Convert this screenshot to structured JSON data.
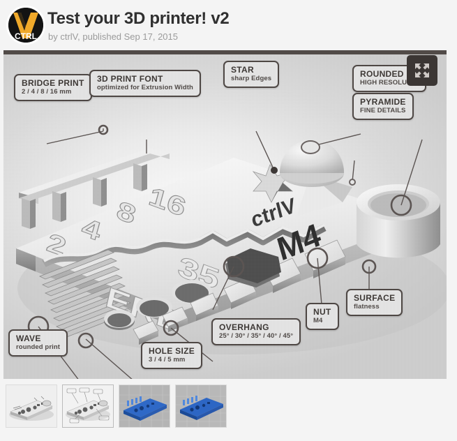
{
  "header": {
    "logo_icon": "ctrlv-logo-icon",
    "logo_text": "CTRL",
    "title": "Test your 3D printer! v2",
    "byline": "by ctrlV, published Sep 17, 2015"
  },
  "viewer": {
    "expand_icon": "expand-arrows-icon",
    "model_text": {
      "brand": "ctrlV",
      "thread": "M4",
      "bridge_numbers": [
        "2",
        "4",
        "8",
        "16"
      ],
      "hole_numbers": [
        "3",
        "4",
        "5"
      ]
    },
    "callouts": [
      {
        "id": "bridge-print",
        "title": "BRIDGE PRINT",
        "sub": "2 / 4 / 8 / 16 mm"
      },
      {
        "id": "3d-print-font",
        "title": "3D PRINT FONT",
        "sub": "optimized for Extrusion Width"
      },
      {
        "id": "star",
        "title": "STAR",
        "sub": "sharp Edges"
      },
      {
        "id": "rounded-print",
        "title": "ROUNDED P",
        "sub": "HIGH RESOLUTIO"
      },
      {
        "id": "pyramide",
        "title": "PYRAMIDE",
        "sub": "FINE DETAILS"
      },
      {
        "id": "wave",
        "title": "WAVE",
        "sub": "rounded print"
      },
      {
        "id": "hole-size",
        "title": "HOLE SIZE",
        "sub": "3 / 4 / 5 mm"
      },
      {
        "id": "overhang",
        "title": "OVERHANG",
        "sub": "25° / 30° / 35° / 40° / 45°"
      },
      {
        "id": "nut",
        "title": "NUT",
        "sub": "M4"
      },
      {
        "id": "surface",
        "title": "SURFACE",
        "sub": "flatness"
      }
    ]
  },
  "thumbnails": [
    {
      "id": "thumb-render-gray",
      "label": "grayscale render"
    },
    {
      "id": "thumb-render-labeled",
      "label": "labeled render",
      "selected": true
    },
    {
      "id": "thumb-print-blue-1",
      "label": "blue print photo 1"
    },
    {
      "id": "thumb-print-blue-2",
      "label": "blue print photo 2"
    }
  ],
  "colors": {
    "page_bg": "#f4f4f4",
    "logo_yellow": "#f0a92a",
    "logo_black": "#131313",
    "topbar": "#514b48",
    "callout_border": "#4d4643",
    "callout_bg": "#e6e6e6",
    "title_text": "#2f2f2f",
    "byline_text": "#9b9b9b",
    "expand_bg": "#3b3634",
    "print_blue": "#2a62c0"
  }
}
